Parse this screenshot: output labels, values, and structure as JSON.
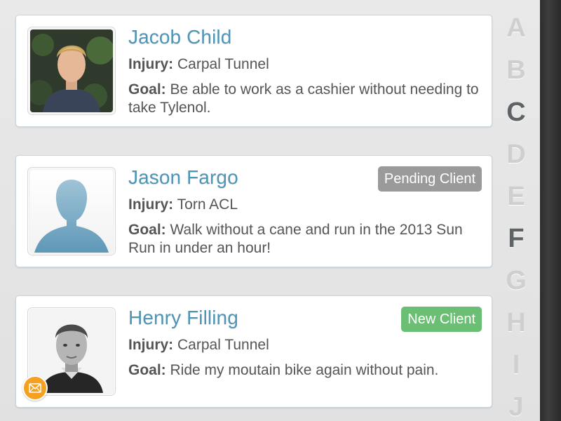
{
  "clients": [
    {
      "name": "Jacob Child",
      "injury_label": "Injury:",
      "injury": "Carpal Tunnel",
      "goal_label": "Goal:",
      "goal": "Be able to work as a cashier without needing to take Tylenol.",
      "status": "",
      "photo": "photo"
    },
    {
      "name": "Jason Fargo",
      "injury_label": "Injury:",
      "injury": "Torn ACL",
      "goal_label": "Goal:",
      "goal": "Walk without a cane and run in the 2013 Sun Run in under an hour!",
      "status": "Pending Client",
      "photo": "placeholder-silhouette"
    },
    {
      "name": "Henry Filling",
      "injury_label": "Injury:",
      "injury": "Carpal Tunnel",
      "goal_label": "Goal:",
      "goal": "Ride my moutain bike again without pain.",
      "status": "New Client",
      "photo": "photo",
      "message_icon": "envelope-icon"
    }
  ],
  "alphabet_index": {
    "letters": [
      "A",
      "B",
      "C",
      "D",
      "E",
      "F",
      "G",
      "H",
      "I",
      "J"
    ],
    "active": [
      "C",
      "F"
    ]
  },
  "colors": {
    "name": "#4f95b6",
    "pending": "#9a9a9a",
    "new": "#6bbf75",
    "mail": "#f5a020"
  }
}
